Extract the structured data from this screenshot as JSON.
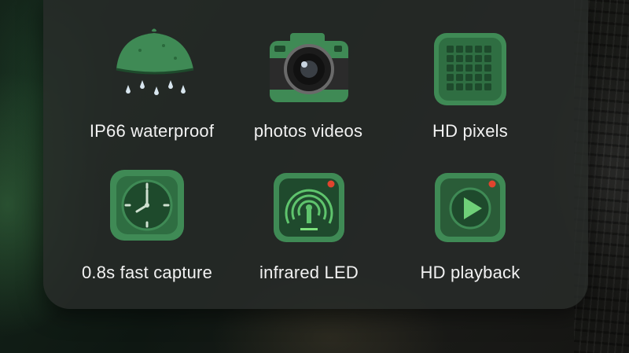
{
  "features": [
    {
      "label": "IP66 waterproof",
      "icon": "umbrella-rain-icon"
    },
    {
      "label": "photos videos",
      "icon": "camera-icon"
    },
    {
      "label": "HD pixels",
      "icon": "pixel-grid-icon"
    },
    {
      "label": "0.8s fast capture",
      "icon": "clock-icon"
    },
    {
      "label": "infrared LED",
      "icon": "infrared-signal-icon"
    },
    {
      "label": "HD playback",
      "icon": "play-icon"
    }
  ],
  "colors": {
    "panel": "#2a2e2c",
    "icon_green": "#3f8a55",
    "icon_dark": "#1e4a2c",
    "led_red": "#e0442e",
    "text": "#f2f2f2"
  }
}
